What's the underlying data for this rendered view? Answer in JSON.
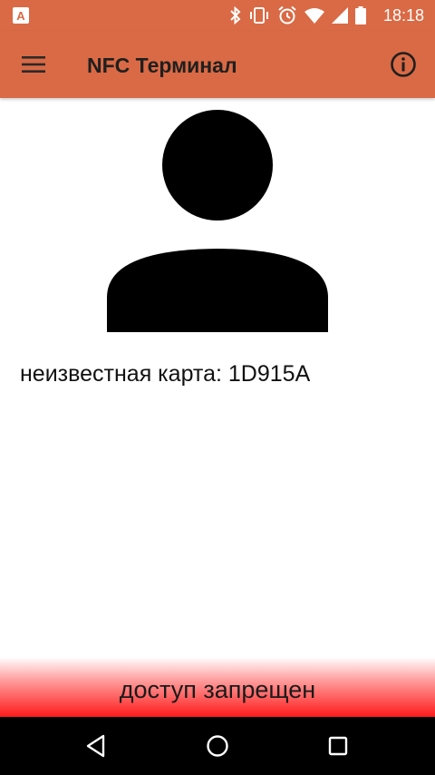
{
  "status_bar": {
    "time": "18:18",
    "app_icon_letter": "A",
    "icons": [
      "bluetooth-icon",
      "vibrate-icon",
      "alarm-icon",
      "wifi-icon",
      "cell-signal-icon",
      "battery-icon"
    ]
  },
  "app_bar": {
    "title": "NFC Терминал",
    "menu_icon": "menu-icon",
    "info_icon": "info-icon"
  },
  "main": {
    "avatar_icon": "person-icon",
    "card_text": "неизвестная карта: 1D915A"
  },
  "banner": {
    "text": "доступ запрещен",
    "color": "#ff1a1a"
  },
  "nav_bar": {
    "icons": [
      "back-icon",
      "home-icon",
      "recents-icon"
    ]
  },
  "colors": {
    "accent": "#d96a45",
    "background": "#ffffff",
    "nav_background": "#000000"
  }
}
